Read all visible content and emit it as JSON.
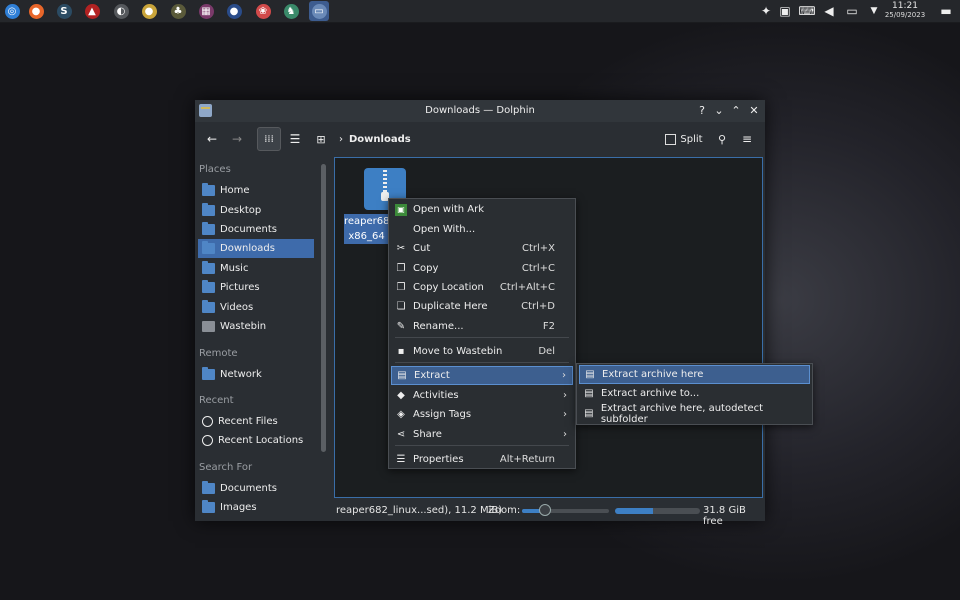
{
  "taskbar": {
    "apps": [
      {
        "icon": "app-launcher-icon",
        "color": "#2f7fd6",
        "glyph": "◎"
      },
      {
        "icon": "firefox-icon",
        "color": "#e8662a",
        "glyph": "●"
      },
      {
        "icon": "s-app-icon",
        "color": "#2b4b63",
        "glyph": "S"
      },
      {
        "icon": "red-triangle-icon",
        "color": "#b22222",
        "glyph": "▲"
      },
      {
        "icon": "aperture-icon",
        "color": "#55585c",
        "glyph": "◐"
      },
      {
        "icon": "chrome-icon",
        "color": "#c9a43a",
        "glyph": "●"
      },
      {
        "icon": "paw-app-icon",
        "color": "#5a5a3a",
        "glyph": "♣"
      },
      {
        "icon": "grid-app-icon",
        "color": "#7a3a6a",
        "glyph": "▦"
      },
      {
        "icon": "blue-circle-icon",
        "color": "#2a4c8a",
        "glyph": "●"
      },
      {
        "icon": "color-wheel-icon",
        "color": "#d24a4a",
        "glyph": "❀"
      },
      {
        "icon": "krita-icon",
        "color": "#3a8a6a",
        "glyph": "♞"
      },
      {
        "icon": "file-manager-icon",
        "color": "#6a8ab8",
        "glyph": "▭"
      }
    ],
    "active_index": 11,
    "clock_time": "11:21",
    "clock_date": "25/09/2023"
  },
  "window": {
    "title": "Downloads — Dolphin",
    "help_glyph": "?",
    "breadcrumb": "Downloads",
    "split_label": "Split"
  },
  "sidebar": {
    "places_label": "Places",
    "places": [
      "Home",
      "Desktop",
      "Documents",
      "Downloads",
      "Music",
      "Pictures",
      "Videos",
      "Wastebin"
    ],
    "remote_label": "Remote",
    "remote": [
      "Network"
    ],
    "recent_label": "Recent",
    "recent": [
      "Recent Files",
      "Recent Locations"
    ],
    "search_label": "Search For",
    "search": [
      "Documents",
      "Images"
    ]
  },
  "file": {
    "name_line1": "reaper682_",
    "name_line2": "x86_64"
  },
  "status": {
    "info": "reaper682_linux...sed), 11.2 MiB)",
    "zoom_label": "Zoom:",
    "zoom_level": 0.27,
    "disk_used": 0.45,
    "free_space": "31.8 GiB free"
  },
  "context_menu": {
    "items": [
      {
        "label": "Open with Ark",
        "icon": "ark-icon",
        "shortcut": ""
      },
      {
        "label": "Open With...",
        "icon": "",
        "shortcut": ""
      },
      {
        "label": "Cut",
        "icon": "scissors-icon",
        "shortcut": "Ctrl+X"
      },
      {
        "label": "Copy",
        "icon": "copy-icon",
        "shortcut": "Ctrl+C"
      },
      {
        "label": "Copy Location",
        "icon": "copy-location-icon",
        "shortcut": "Ctrl+Alt+C"
      },
      {
        "label": "Duplicate Here",
        "icon": "duplicate-icon",
        "shortcut": "Ctrl+D"
      },
      {
        "label": "Rename...",
        "icon": "pencil-icon",
        "shortcut": "F2"
      },
      {
        "label": "Move to Wastebin",
        "icon": "trash-icon",
        "shortcut": "Del"
      },
      {
        "label": "Extract",
        "icon": "archive-icon",
        "shortcut": ""
      },
      {
        "label": "Activities",
        "icon": "activities-icon",
        "shortcut": ""
      },
      {
        "label": "Assign Tags",
        "icon": "tag-icon",
        "shortcut": ""
      },
      {
        "label": "Share",
        "icon": "share-icon",
        "shortcut": ""
      },
      {
        "label": "Properties",
        "icon": "properties-icon",
        "shortcut": "Alt+Return"
      }
    ]
  },
  "submenu": {
    "items": [
      {
        "label": "Extract archive here",
        "icon": "archive-icon"
      },
      {
        "label": "Extract archive to...",
        "icon": "archive-icon"
      },
      {
        "label": "Extract archive here, autodetect subfolder",
        "icon": "archive-icon"
      }
    ]
  }
}
